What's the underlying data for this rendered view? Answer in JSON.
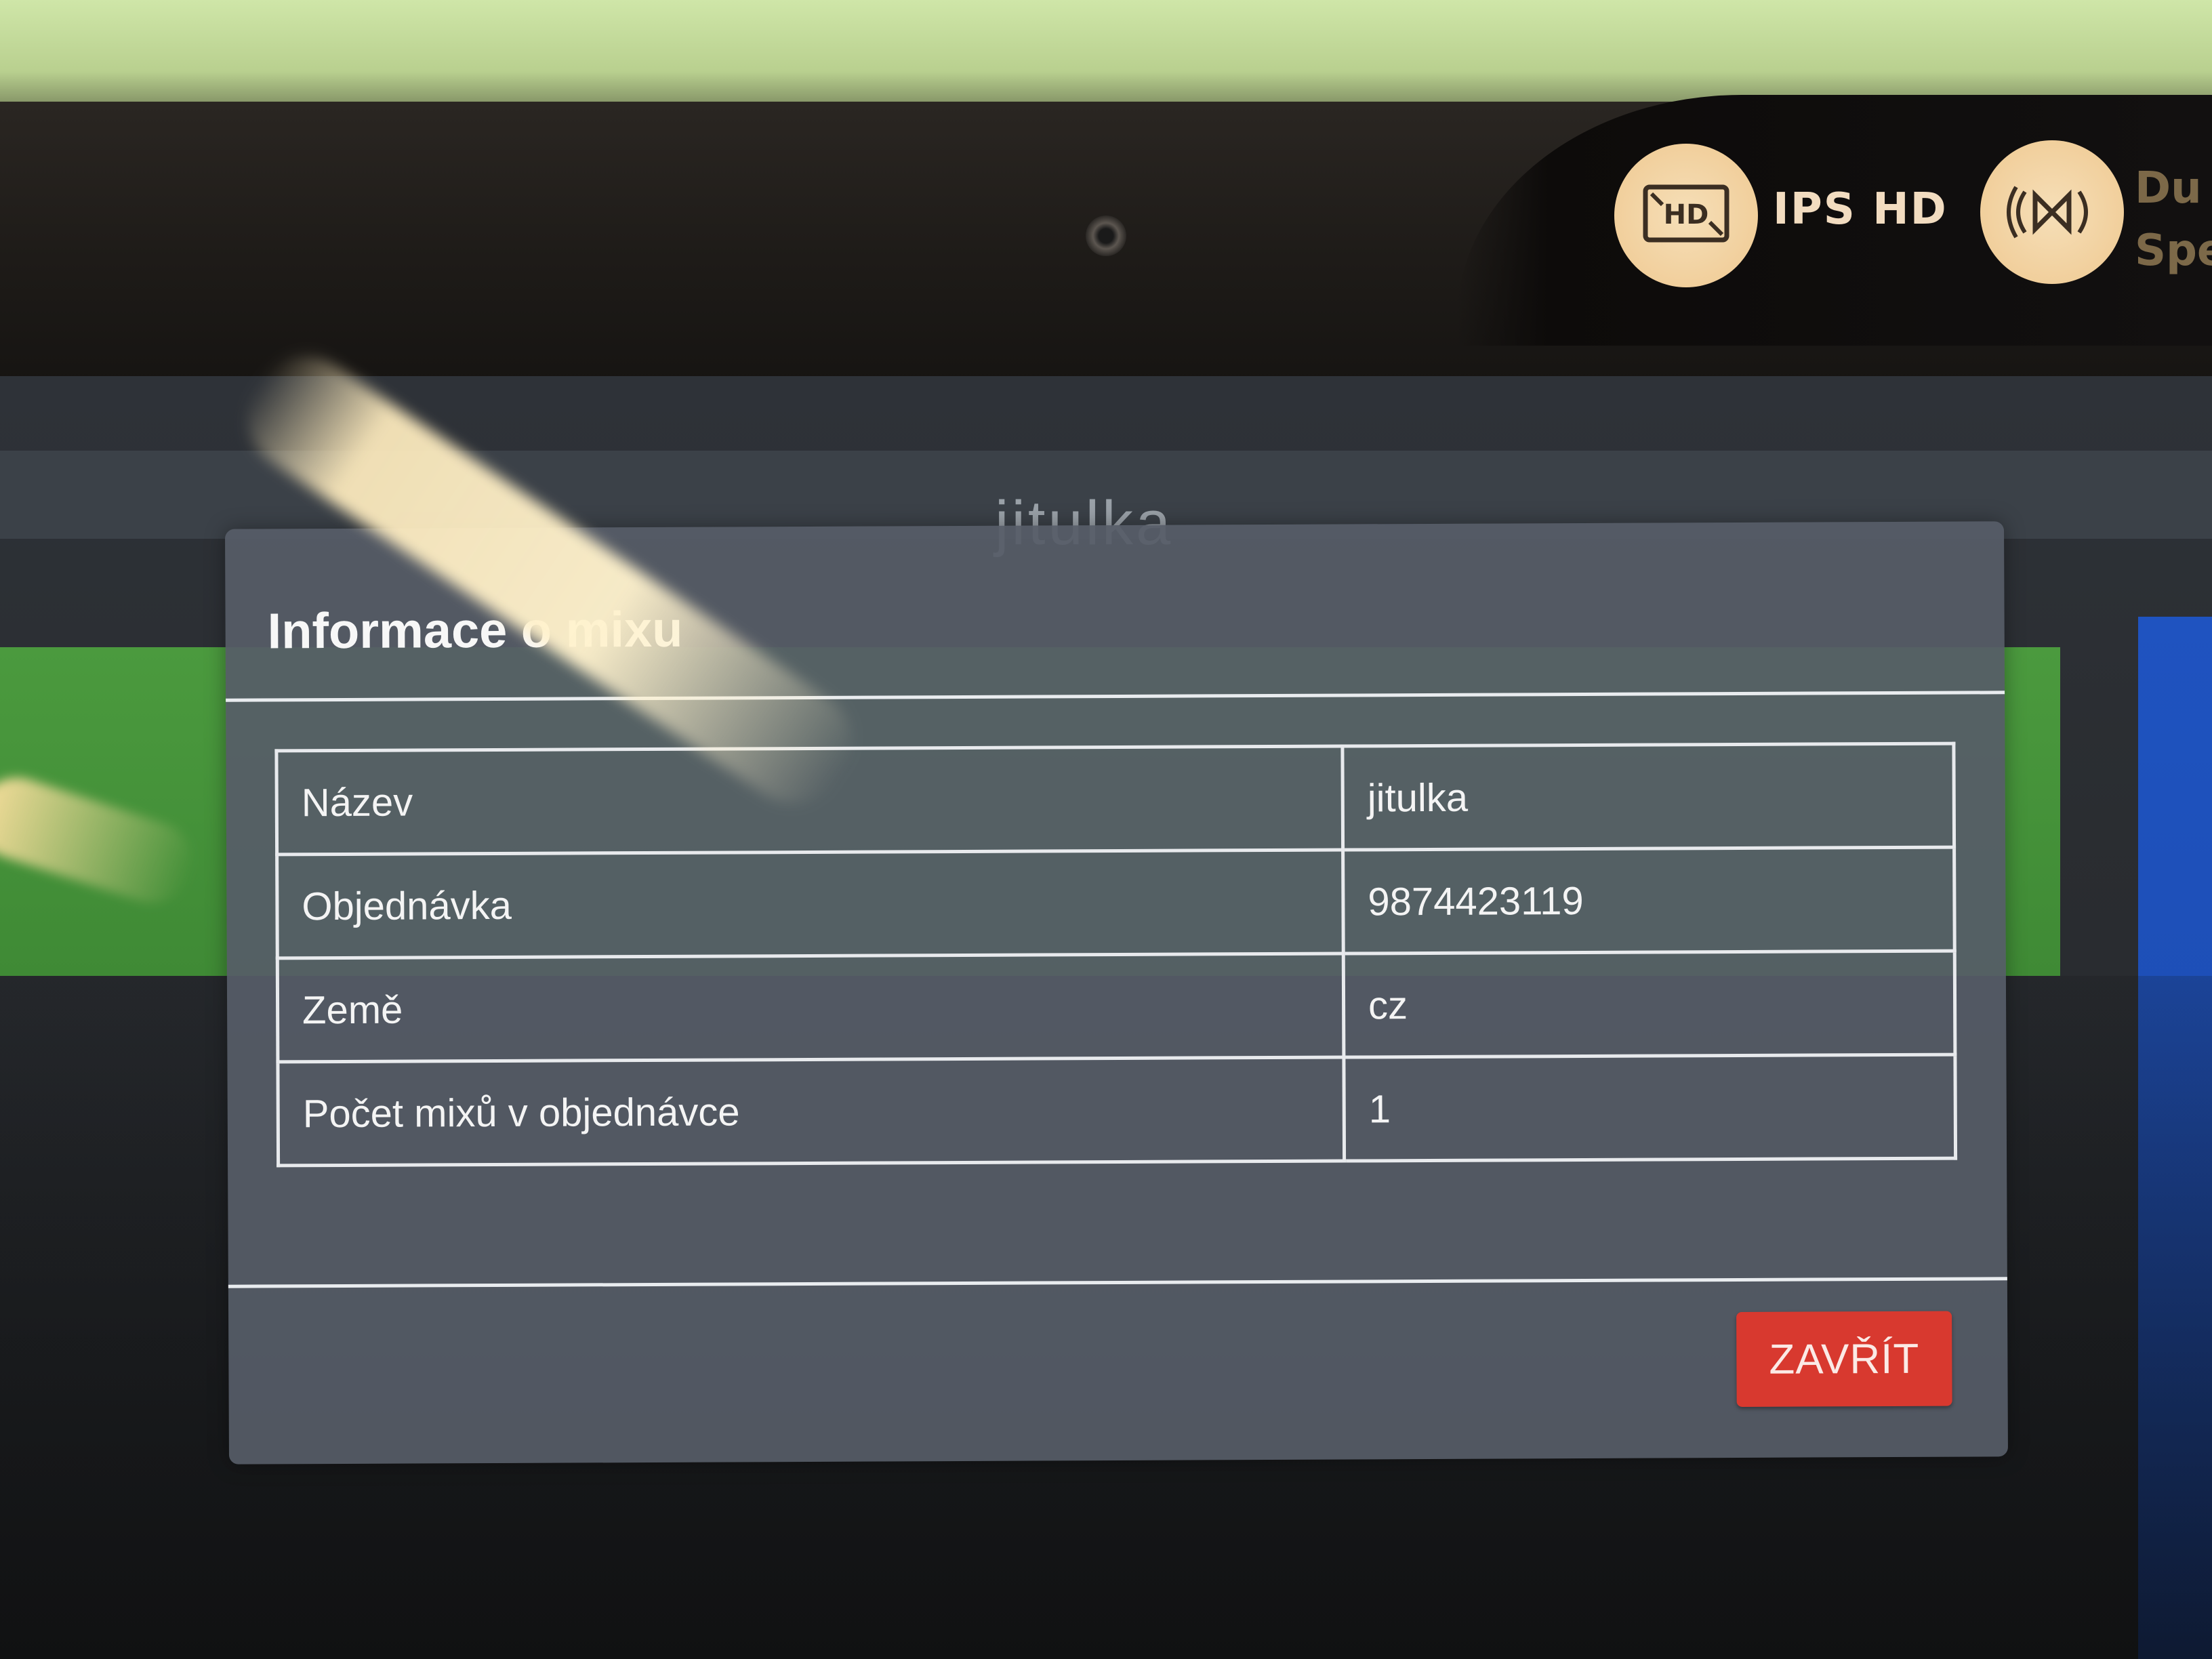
{
  "bezel": {
    "badge_hd_icon": "hd-display-icon",
    "badge_hd_label": "IPS HD",
    "badge_speaker_icon": "speaker-icon",
    "badge_speaker_label_partial": "Du\nSpe"
  },
  "app": {
    "title": "jitulka"
  },
  "dialog": {
    "title": "Informace o mixu",
    "rows": [
      {
        "label": "Název",
        "value": "jitulka"
      },
      {
        "label": "Objednávka",
        "value": "9874423119"
      },
      {
        "label": "Země",
        "value": "cz"
      },
      {
        "label": "Počet mixů v objednávce",
        "value": "1"
      }
    ],
    "close_label": "ZAVŘÍT"
  },
  "colors": {
    "close_button": "#d8392f",
    "dialog_background": "#565d67",
    "green_strip": "#4b9a3e",
    "blue_panel": "#1f53c0",
    "badge": "#f1cf9c"
  }
}
